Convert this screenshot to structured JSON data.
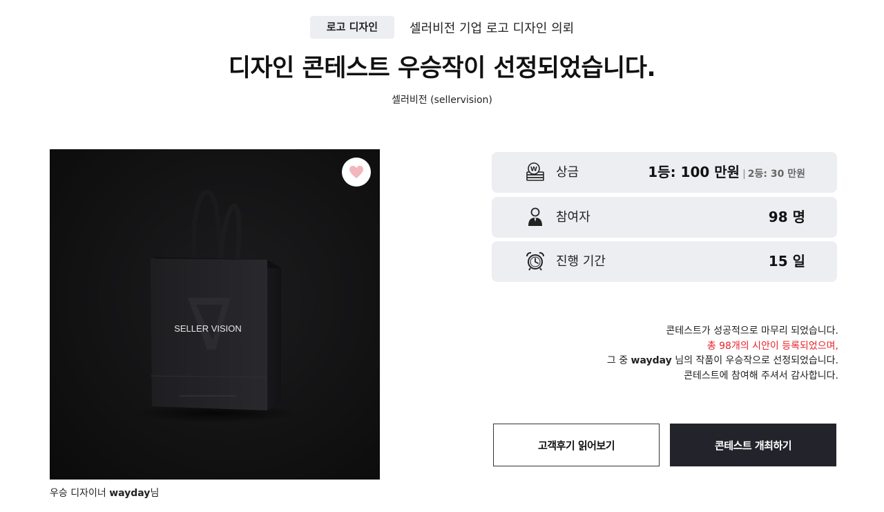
{
  "header": {
    "category_badge": "로고 디자인",
    "breadcrumb": "셀러비전 기업 로고 디자인 의뢰",
    "title": "디자인 콘테스트 우승작이 선정되었습니다.",
    "client": "셀러비전 (sellervision)"
  },
  "showcase": {
    "product_text": "SELLER VISION",
    "like_icon": "heart-icon",
    "caption_prefix": "우승 디자이너 ",
    "caption_name": "wayday",
    "caption_suffix": "님"
  },
  "stats": {
    "prize": {
      "icon": "coin-stack-icon",
      "label": "상금",
      "value": "1등: 100 만원",
      "separator": "|",
      "sub_value": "2등: 30 만원"
    },
    "participants": {
      "icon": "person-icon",
      "label": "참여자",
      "value": "98 명"
    },
    "duration": {
      "icon": "alarm-clock-icon",
      "label": "진행 기간",
      "value": "15 일"
    }
  },
  "message": {
    "line1": "콘테스트가 성공적으로 마무리 되었습니다.",
    "line2": "총 98개의 시안이 등록되었으며,",
    "line3_prefix": "그 중 ",
    "line3_name": "wayday",
    "line3_suffix": " 님의 작품이 우승작으로 선정되었습니다.",
    "line4": "콘테스트에 참여해 주셔서 감사합니다."
  },
  "actions": {
    "reviews_label": "고객후기 읽어보기",
    "host_label": "콘테스트 개최하기"
  },
  "colors": {
    "card_bg": "#eceef1",
    "highlight": "#e8232b",
    "dark_button": "#23232b",
    "heart": "#f3b6bd"
  }
}
